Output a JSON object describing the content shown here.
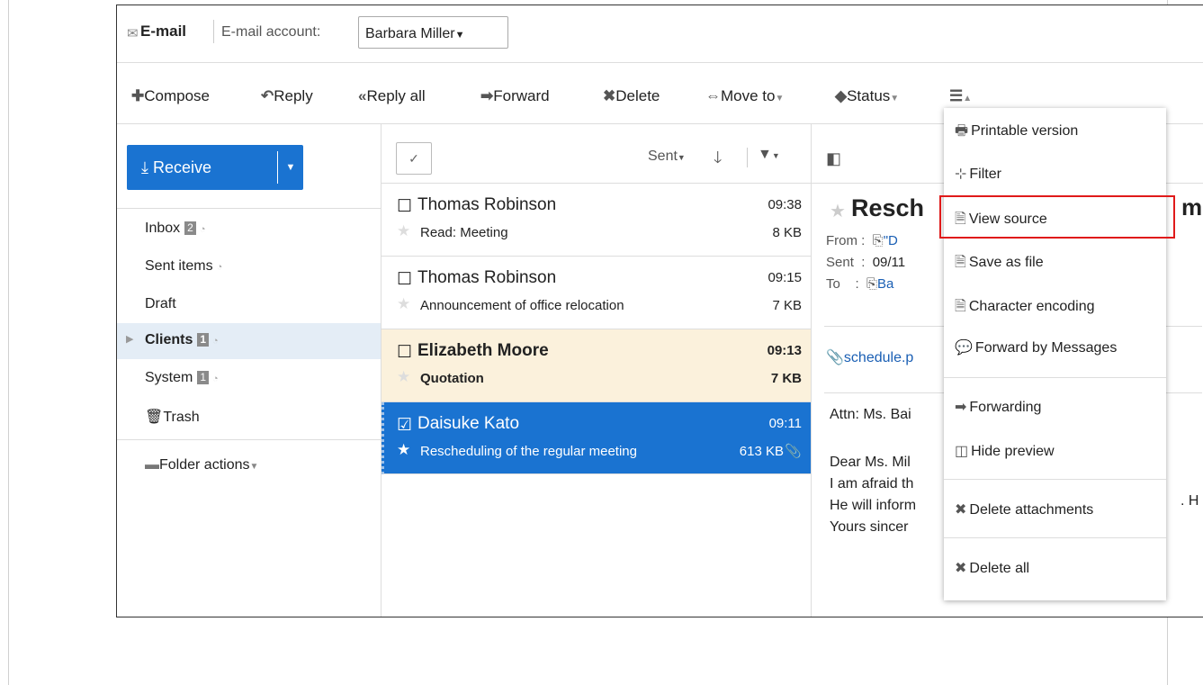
{
  "window": {
    "app_title": "E-mail",
    "account_label": "E-mail account:",
    "account_value": "Barbara Miller"
  },
  "toolbar": {
    "compose": "Compose",
    "reply": "Reply",
    "reply_all": "Reply all",
    "forward": "Forward",
    "delete": "Delete",
    "move_to": "Move to",
    "status": "Status"
  },
  "sidebar": {
    "receive": "Receive",
    "folders": [
      {
        "label": "Inbox",
        "badge": "2"
      },
      {
        "label": "Sent items",
        "badge": ""
      },
      {
        "label": "Draft",
        "badge": ""
      },
      {
        "label": "Clients",
        "badge": "1"
      },
      {
        "label": "System",
        "badge": "1"
      },
      {
        "label": "Trash",
        "badge": ""
      }
    ],
    "folder_actions": "Folder actions"
  },
  "list": {
    "sort_label": "Sent",
    "mails": [
      {
        "from": "Thomas Robinson",
        "time": "09:38",
        "subject": "Read: Meeting",
        "size": "8 KB"
      },
      {
        "from": "Thomas Robinson",
        "time": "09:15",
        "subject": "Announcement of office relocation",
        "size": "7 KB"
      },
      {
        "from": "Elizabeth Moore",
        "time": "09:13",
        "subject": "Quotation",
        "size": "7 KB"
      },
      {
        "from": "Daisuke Kato",
        "time": "09:11",
        "subject": "Rescheduling of the regular meeting",
        "size": "613 KB"
      }
    ]
  },
  "preview": {
    "subject": "Resch",
    "subject_tail": "m",
    "from_label": "From",
    "from_value": "\"D",
    "sent_label": "Sent",
    "sent_value": "09/11",
    "to_label": "To",
    "to_value": "Ba",
    "attachment": "schedule.p",
    "body": [
      "Attn: Ms. Bai",
      "Dear Ms. Mil",
      "I am afraid th",
      "He will inform",
      "Yours sincer"
    ],
    "body_tail": ". H"
  },
  "menu": {
    "items": [
      "Printable version",
      "Filter",
      "View source",
      "Save as file",
      "Character encoding",
      "Forward by Messages",
      "Forwarding",
      "Hide preview",
      "Delete attachments",
      "Delete all"
    ]
  },
  "colors": {
    "accent": "#1a73d1",
    "highlight_row": "#fbf1dc",
    "selected_folder": "#e4edf6",
    "annotation_box": "#e01a1a"
  }
}
